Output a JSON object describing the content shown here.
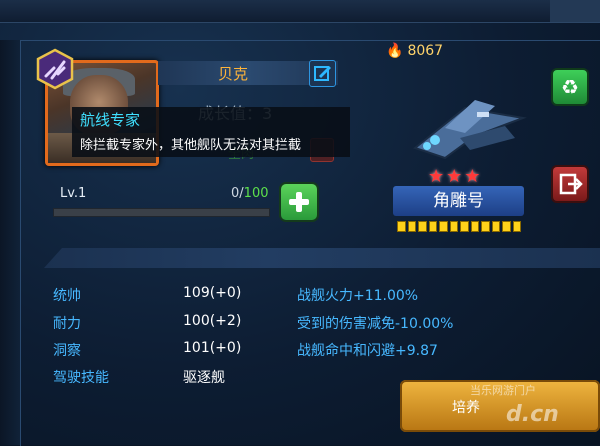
{
  "resources": {
    "gold": "8067"
  },
  "officer": {
    "name": "贝克",
    "growth": "成长值：3",
    "faded_label": "全肉",
    "level": "Lv.1",
    "exp_current": "0",
    "exp_max": "100",
    "exp_progress": 0
  },
  "tooltip": {
    "title": "航线专家",
    "description": "除拦截专家外，其他舰队无法对其拦截"
  },
  "ship": {
    "name": "角雕号",
    "stars": "★★★",
    "star_count": 3,
    "level_pips": 12
  },
  "stats": [
    {
      "label": "统帅",
      "value": "109(+0)",
      "effect": "战舰火力+11.00%"
    },
    {
      "label": "耐力",
      "value": "100(+2)",
      "effect": "受到的伤害减免-10.00%"
    },
    {
      "label": "洞察",
      "value": "101(+0)",
      "effect": "战舰命中和闪避+9.87"
    },
    {
      "label": "驾驶技能",
      "value": "驱逐舰",
      "effect": ""
    }
  ],
  "buttons": {
    "train": "培养"
  },
  "watermark": {
    "line1": "当乐网游门户",
    "line2": "d.cn"
  },
  "colors": {
    "accent_blue": "#47b8ff",
    "name_orange": "#ffb43a",
    "exp_green": "#5de04b"
  },
  "icons": [
    "skill-badge-icon",
    "edit-icon",
    "plus-icon",
    "recycle-icon",
    "exit-icon",
    "gold-flame-icon"
  ]
}
